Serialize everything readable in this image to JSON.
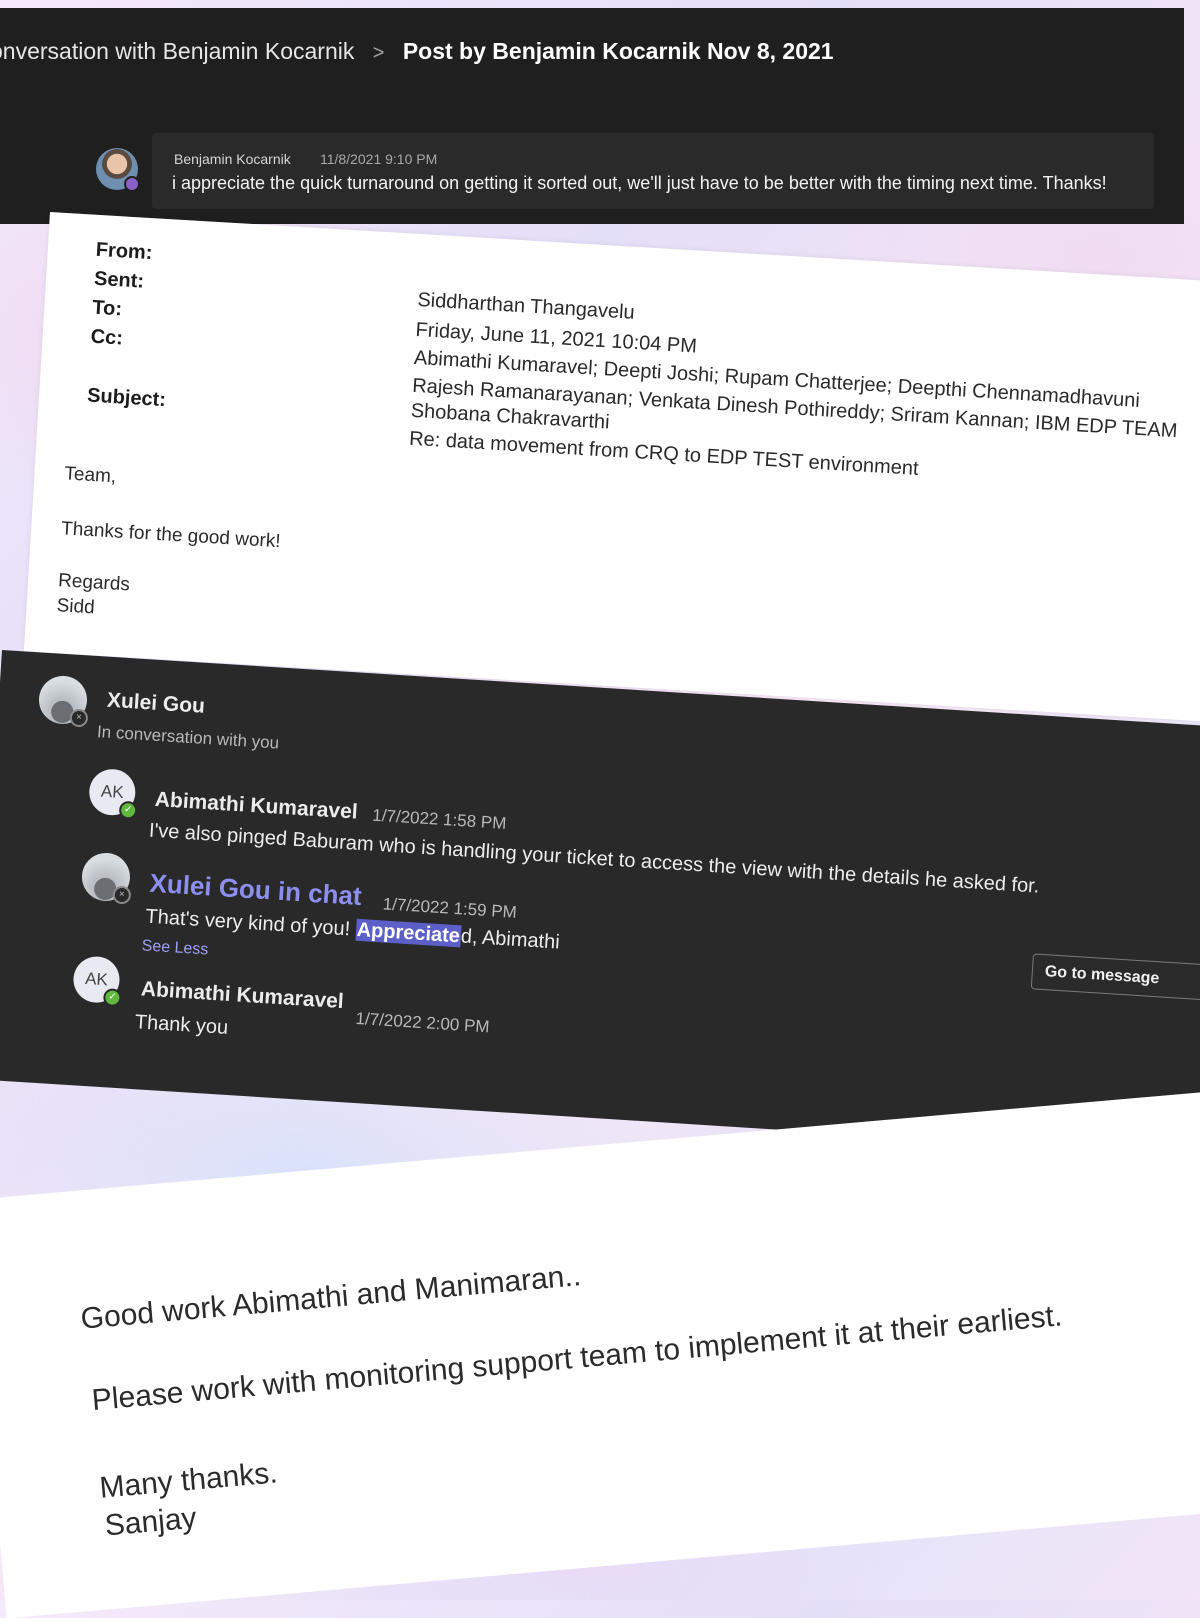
{
  "post": {
    "breadcrumb_prev": "onversation with Benjamin Kocarnik",
    "breadcrumb_sep": ">",
    "breadcrumb_current": "Post by Benjamin Kocarnik Nov 8, 2021",
    "author": "Benjamin Kocarnik",
    "time": "11/8/2021 9:10 PM",
    "message": "i appreciate the quick turnaround on getting it sorted out, we'll just have to be better with the timing next time. Thanks!"
  },
  "email": {
    "labels": {
      "from": "From:",
      "sent": "Sent:",
      "to": "To:",
      "cc": "Cc:",
      "subject": "Subject:"
    },
    "from": "Siddharthan Thangavelu",
    "sent": "Friday, June 11, 2021 10:04 PM",
    "to": "Abimathi Kumaravel; Deepti Joshi; Rupam Chatterjee; Deepthi Chennamadhavuni",
    "cc_line1": "Rajesh Ramanarayanan; Venkata Dinesh Pothireddy; Sriram Kannan; IBM EDP TEAM",
    "cc_line2": "Shobana Chakravarthi",
    "subject": "Re: data movement from CRQ to EDP TEST environment",
    "greeting": "Team,",
    "body": "Thanks for the good work!",
    "closing": "Regards",
    "signature": "Sidd"
  },
  "chat": {
    "title": "Xulei Gou",
    "subtitle": "In conversation with you",
    "msg1": {
      "initials": "AK",
      "author": "Abimathi Kumaravel",
      "time": "1/7/2022 1:58 PM",
      "text": "I've also pinged Baburam who is handling your ticket to access the view with the details he asked for."
    },
    "msg2": {
      "author_link": "Xulei Gou in chat",
      "time": "1/7/2022 1:59 PM",
      "text_before": "That's very kind of you!",
      "text_highlight": "Appreciate",
      "text_after": "d, Abimathi",
      "see_less": "See Less"
    },
    "msg3": {
      "initials": "AK",
      "author": "Abimathi Kumaravel",
      "time": "1/7/2022 2:00 PM",
      "text": "Thank you"
    },
    "go_to_message": "Go to message"
  },
  "note": {
    "line1": "Good work Abimathi and Manimaran..",
    "line2": "Please work with monitoring support team to implement it at their earliest.",
    "line3": "Many thanks.",
    "line4": "Sanjay"
  },
  "colors": {
    "teams_dark": "#1f1f1f",
    "chat_dark": "#292929",
    "link_purple": "#8c8ff0",
    "highlight": "#5b5fc7",
    "presence_available": "#5fb83d"
  }
}
